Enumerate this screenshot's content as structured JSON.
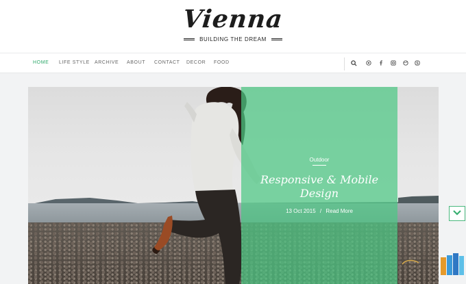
{
  "brand": {
    "logo_text": "Vienna",
    "tagline": "BUILDING THE DREAM"
  },
  "nav": {
    "items": [
      {
        "label": "HOME",
        "active": true
      },
      {
        "label": "LIFE STYLE",
        "active": false
      },
      {
        "label": "ARCHIVE",
        "active": false
      },
      {
        "label": "ABOUT",
        "active": false
      },
      {
        "label": "CONTACT",
        "active": false
      },
      {
        "label": "DECOR",
        "active": false
      },
      {
        "label": "FOOD",
        "active": false
      }
    ],
    "icons": [
      "search-icon",
      "instagram-icon",
      "facebook-icon",
      "camera-icon",
      "dribbble-icon",
      "skype-icon"
    ]
  },
  "hero": {
    "category": "Outdoor",
    "title_line1": "Responsive & Mobile",
    "title_line2": "Design",
    "date": "13 Oct 2015",
    "separator": "/",
    "read_more": "Read More"
  },
  "colors": {
    "accent": "#2ea86a",
    "overlay": "#4cc884",
    "background": "#f2f3f4"
  }
}
